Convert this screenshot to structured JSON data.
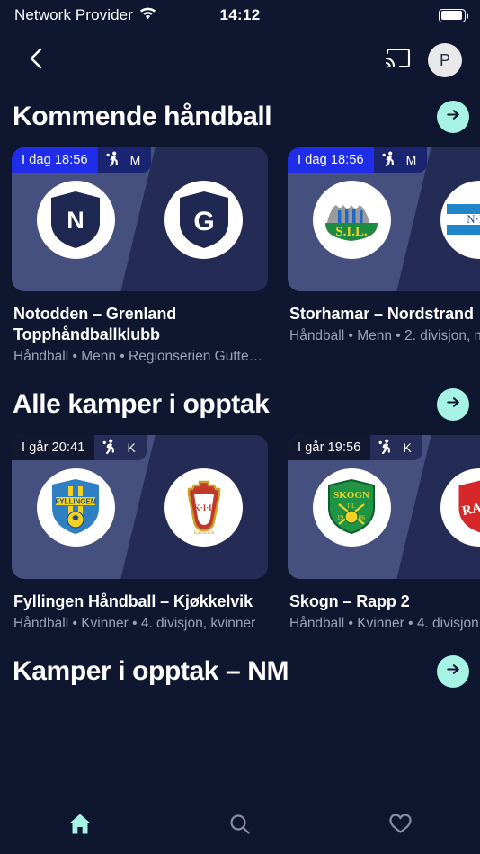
{
  "status_bar": {
    "carrier": "Network Provider",
    "wifi_icon": "wifi-icon",
    "time": "14:12",
    "battery_icon": "battery-icon"
  },
  "nav_bar": {
    "back_icon": "chevron-left-icon",
    "cast_icon": "cast-icon",
    "avatar_initial": "P"
  },
  "colors": {
    "background": "#0e1630",
    "accent_mint": "#a6f2e3",
    "badge_blue": "#1f2de8",
    "card_left": "#46507f",
    "card_right": "#242c56",
    "subtitle": "#9aa2bb"
  },
  "sections": [
    {
      "title": "Kommende håndball",
      "arrow_icon": "arrow-right-icon",
      "cards": [
        {
          "badge_time": "I dag 18:56",
          "badge_sport_icon": "handball-player-icon",
          "badge_gender": "M",
          "badge_style": "upcoming",
          "title": "Notodden – Grenland Topphåndballklubb",
          "subtitle": "Håndball • Menn • Regionserien Gutter…",
          "home_crest": "notodden-crest",
          "away_crest": "grenland-crest"
        },
        {
          "badge_time": "I dag 18:56",
          "badge_sport_icon": "handball-player-icon",
          "badge_gender": "M",
          "badge_style": "upcoming",
          "title": "Storhamar   – Nordstrand",
          "subtitle": "Håndball • Menn • 2. divisjon, m",
          "home_crest": "storhamar-crest",
          "away_crest": "nordstrand-crest"
        }
      ]
    },
    {
      "title": "Alle kamper i opptak",
      "arrow_icon": "arrow-right-icon",
      "cards": [
        {
          "badge_time": "I går 20:41",
          "badge_sport_icon": "handball-player-icon",
          "badge_gender": "K",
          "badge_style": "recorded",
          "title": "Fyllingen Håndball – Kjøkkelvik",
          "subtitle": "Håndball • Kvinner • 4. divisjon, kvinner",
          "home_crest": "fyllingen-crest",
          "away_crest": "kjokkelvik-crest"
        },
        {
          "badge_time": "I går 19:56",
          "badge_sport_icon": "handball-player-icon",
          "badge_gender": "K",
          "badge_style": "recorded",
          "title": "Skogn – Rapp 2",
          "subtitle": "Håndball • Kvinner • 4. divisjon",
          "home_crest": "skogn-crest",
          "away_crest": "rapp-crest"
        }
      ]
    }
  ],
  "cut_section": {
    "title": "Kamper i opptak – NM",
    "arrow_icon": "arrow-right-icon"
  },
  "tab_bar": {
    "items": [
      {
        "name": "home",
        "icon": "home-icon",
        "active": true
      },
      {
        "name": "search",
        "icon": "search-icon",
        "active": false
      },
      {
        "name": "favorites",
        "icon": "heart-icon",
        "active": false
      }
    ]
  }
}
